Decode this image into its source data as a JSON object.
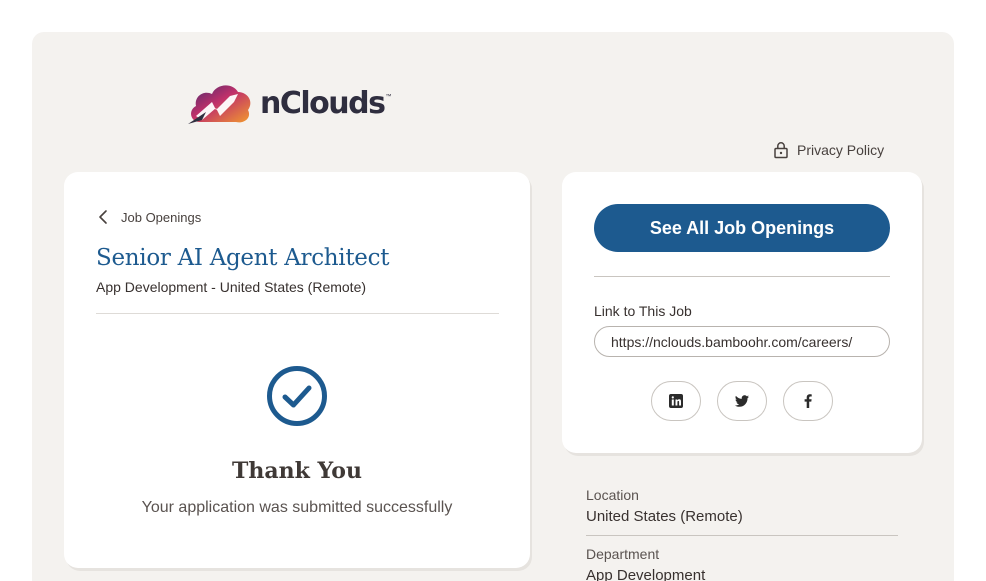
{
  "brand": {
    "name": "nClouds",
    "tm": "™"
  },
  "header": {
    "privacy_label": "Privacy Policy"
  },
  "job": {
    "back_label": "Job Openings",
    "title": "Senior AI Agent Architect",
    "subtitle": "App Development - United States (Remote)"
  },
  "confirmation": {
    "title": "Thank You",
    "message": "Your application was submitted successfully"
  },
  "sidebar": {
    "all_jobs_label": "See All Job Openings",
    "link_label": "Link to This Job",
    "link_value": "https://nclouds.bamboohr.com/careers/",
    "social": [
      "linkedin-icon",
      "twitter-icon",
      "facebook-icon"
    ]
  },
  "details": {
    "location_label": "Location",
    "location_value": "United States (Remote)",
    "department_label": "Department",
    "department_value": "App Development"
  },
  "colors": {
    "primary": "#1d5a8f",
    "panel_bg": "#f4f2ef",
    "card_bg": "#ffffff",
    "text": "#38312f"
  }
}
